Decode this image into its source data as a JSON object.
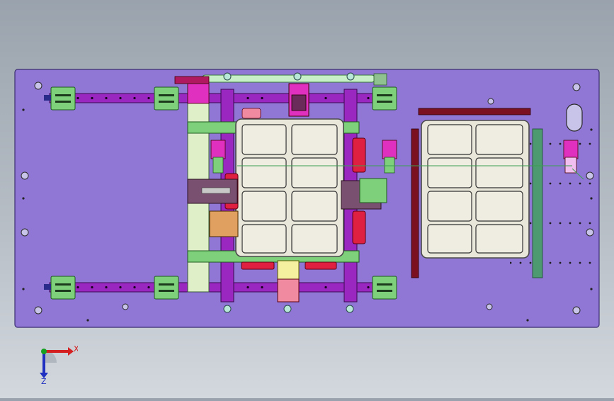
{
  "viewport": {
    "view_orientation": "top"
  },
  "triad": {
    "x_label": "X",
    "z_label": "Z",
    "x_color": "#d42020",
    "y_color": "#16a020",
    "z_color": "#2030c0"
  },
  "colors": {
    "base_plate": "#9077d6",
    "rail": "#9a28c0",
    "tray": "#e9e6da",
    "tray_border": "#4a4a4a",
    "clamp_green": "#7ed07a",
    "magenta": "#e030c0",
    "red_block": "#e02040",
    "dark_red_bar": "#7a1020",
    "teal_bar": "#4e9a70",
    "shaft": "#c8f0c8",
    "background_top": "#9aa3ad",
    "background_bottom": "#d3d8de"
  }
}
